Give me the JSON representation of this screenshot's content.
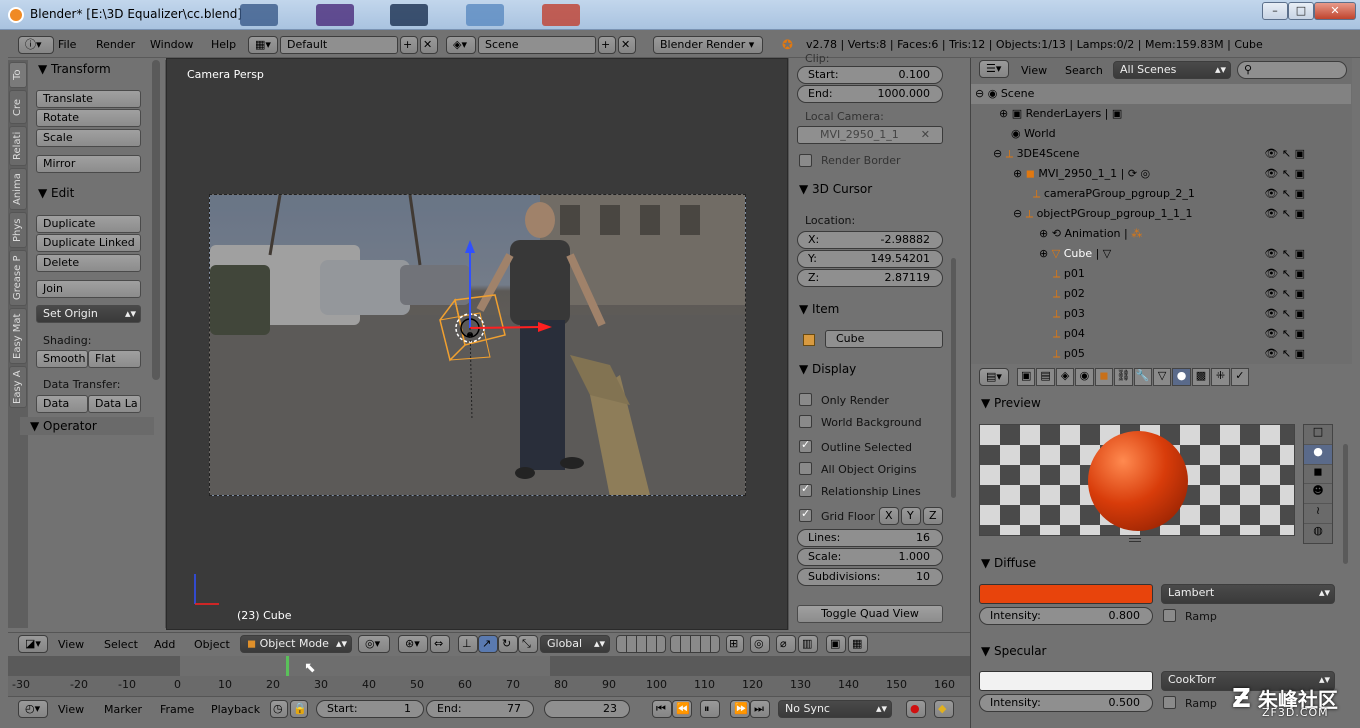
{
  "window": {
    "title": "Blender* [E:\\3D Equalizer\\cc.blend]",
    "minimize": "–",
    "maximize": "□",
    "close": "✕"
  },
  "info": {
    "menus": [
      "File",
      "Render",
      "Window",
      "Help"
    ],
    "screen_layout": "Default",
    "scene": "Scene",
    "engine": "Blender Render",
    "stats": "v2.78 | Verts:8 | Faces:6 | Tris:12 | Objects:1/13 | Lamps:0/2 | Mem:159.83M | Cube"
  },
  "tool_tabs": [
    "To",
    "Cre",
    "Relati",
    "Anima",
    "Phys",
    "Grease P",
    "Easy Mat",
    "Easy A"
  ],
  "toolshelf": {
    "transform_header": "Transform",
    "translate": "Translate",
    "rotate": "Rotate",
    "scale": "Scale",
    "mirror": "Mirror",
    "edit_header": "Edit",
    "duplicate": "Duplicate",
    "duplicate_linked": "Duplicate Linked",
    "delete": "Delete",
    "join": "Join",
    "set_origin": "Set Origin",
    "shading_label": "Shading:",
    "smooth": "Smooth",
    "flat": "Flat",
    "data_transfer_label": "Data Transfer:",
    "data": "Data",
    "data_la": "Data La",
    "operator_header": "Operator"
  },
  "viewport": {
    "view_name": "Camera Persp",
    "object_label": "(23) Cube"
  },
  "npanel": {
    "clip_label": "Clip:",
    "start_label": "Start:",
    "start_value": "0.100",
    "end_label": "End:",
    "end_value": "1000.000",
    "local_camera_label": "Local Camera:",
    "local_camera_value": "MVI_2950_1_1",
    "render_border": "Render Border",
    "cursor_header": "3D Cursor",
    "location_label": "Location:",
    "x_label": "X:",
    "x_value": "-2.98882",
    "y_label": "Y:",
    "y_value": "149.54201",
    "z_label": "Z:",
    "z_value": "2.87119",
    "item_header": "Item",
    "item_name": "Cube",
    "display_header": "Display",
    "only_render": "Only Render",
    "world_background": "World Background",
    "outline_selected": "Outline Selected",
    "all_object_origins": "All Object Origins",
    "relationship_lines": "Relationship Lines",
    "grid_floor": "Grid Floor",
    "axis_x": "X",
    "axis_y": "Y",
    "axis_z": "Z",
    "lines_label": "Lines:",
    "lines_value": "16",
    "scale_label": "Scale:",
    "scale_value": "1.000",
    "subdivisions_label": "Subdivisions:",
    "subdivisions_value": "10",
    "toggle_quad": "Toggle Quad View"
  },
  "outliner": {
    "view": "View",
    "search": "Search",
    "filter": "All Scenes",
    "rows": [
      {
        "label": "Scene"
      },
      {
        "label": "RenderLayers"
      },
      {
        "label": "World"
      },
      {
        "label": "3DE4Scene"
      },
      {
        "label": "MVI_2950_1_1"
      },
      {
        "label": "cameraPGroup_pgroup_2_1"
      },
      {
        "label": "objectPGroup_pgroup_1_1_1"
      },
      {
        "label": "Animation"
      },
      {
        "label": "Cube"
      },
      {
        "label": "p01"
      },
      {
        "label": "p02"
      },
      {
        "label": "p03"
      },
      {
        "label": "p04"
      },
      {
        "label": "p05"
      }
    ]
  },
  "material": {
    "preview_header": "Preview",
    "diffuse_header": "Diffuse",
    "diffuse_color": "#e8440c",
    "diffuse_shader": "Lambert",
    "intensity_label": "Intensity:",
    "diffuse_intensity": "0.800",
    "ramp": "Ramp",
    "specular_header": "Specular",
    "specular_color": "#f2f2f2",
    "specular_shader": "CookTorr",
    "specular_intensity": "0.500"
  },
  "viewport_header": {
    "view": "View",
    "select": "Select",
    "add": "Add",
    "object": "Object",
    "mode": "Object Mode",
    "orientation": "Global"
  },
  "timeline": {
    "ticks": [
      "-30",
      "-20",
      "-10",
      "0",
      "10",
      "20",
      "30",
      "40",
      "50",
      "60",
      "70",
      "80",
      "90",
      "100",
      "110",
      "120",
      "130",
      "140",
      "150",
      "160"
    ],
    "view": "View",
    "marker": "Marker",
    "frame": "Frame",
    "playback": "Playback",
    "start_label": "Start:",
    "start": "1",
    "end_label": "End:",
    "end": "77",
    "current": "23",
    "sync": "No Sync"
  },
  "watermark": {
    "brand": "朱峰社区",
    "url": "ZF3D.COM"
  }
}
